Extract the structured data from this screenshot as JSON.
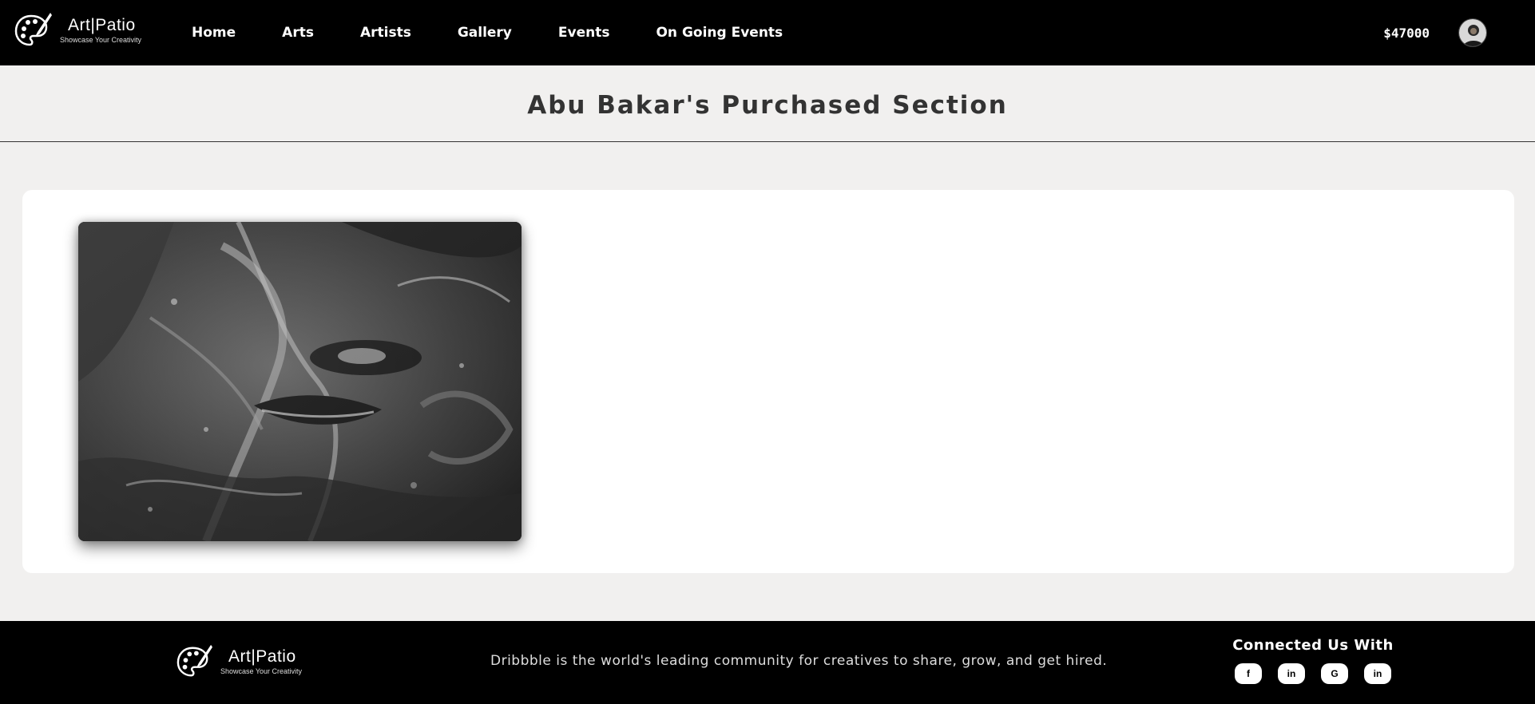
{
  "brand": {
    "name": "Art|Patio",
    "tagline": "Showcase Your Creativity"
  },
  "nav": {
    "items": [
      {
        "label": "Home"
      },
      {
        "label": "Arts"
      },
      {
        "label": "Artists"
      },
      {
        "label": "Gallery"
      },
      {
        "label": "Events"
      },
      {
        "label": "On Going Events"
      }
    ]
  },
  "header": {
    "balance": "$47000",
    "avatar_icon": "user-avatar"
  },
  "page": {
    "title": "Abu Bakar's Purchased Section"
  },
  "purchases": [
    {
      "image_icon": "charcoal-portrait-artwork"
    }
  ],
  "footer": {
    "brand_name": "Art|Patio",
    "brand_tagline": "Showcase Your Creativity",
    "description": "Dribbble is the world's leading community for creatives to share, grow, and get hired.",
    "connect_title": "Connected Us With",
    "socials": [
      {
        "label": "f",
        "icon": "facebook-icon"
      },
      {
        "label": "in",
        "icon": "linkedin-icon"
      },
      {
        "label": "G",
        "icon": "google-icon"
      },
      {
        "label": "in",
        "icon": "linkedin-icon"
      }
    ]
  },
  "colors": {
    "header_bg": "#000000",
    "page_bg": "#f1f0ef",
    "card_bg": "#ffffff",
    "text_light": "#ffffff"
  }
}
